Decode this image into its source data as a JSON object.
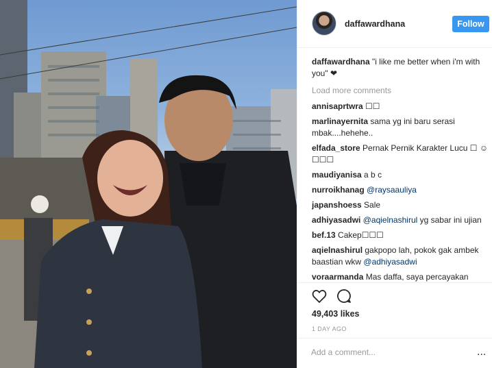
{
  "post": {
    "username": "daffawardhana",
    "follow_label": "Follow",
    "avatar_icon": "profile-avatar",
    "photo_icon": "couple-photo"
  },
  "caption": {
    "username": "daffawardhana",
    "text": "\"i like me better when i'm with you\" ❤"
  },
  "load_more": "Load more comments",
  "comments": [
    {
      "user": "annisaprtwra",
      "text": "☐☐"
    },
    {
      "user": "marlinayernita",
      "text": "sama yg ini baru serasi mbak....hehehe.."
    },
    {
      "user": "elfada_store",
      "text": "Pernak Pernik Karakter Lucu ☐ ☺☐☐☐"
    },
    {
      "user": "maudiyanisa",
      "text": "a b c"
    },
    {
      "user": "nurroikhanag",
      "mention": "@raysaauliya"
    },
    {
      "user": "japanshoess",
      "text": "Sale"
    },
    {
      "user": "adhiyasadwi",
      "mention": "@aqielnashirul",
      "text2": "yg sabar ini ujian"
    },
    {
      "user": "bef.13",
      "text": "Cakep☐☐☐"
    },
    {
      "user": "aqielnashirul",
      "text": "gakpopo lah, pokok gak ambek baastian wkw",
      "mention2": "@adhiyasadwi"
    },
    {
      "user": "voraarmanda",
      "text": "Mas daffa, saya percayakan"
    }
  ],
  "actions": {
    "heart_icon": "heart-icon",
    "comment_icon": "comment-icon",
    "likes": "49,403 likes",
    "time": "1 DAY AGO"
  },
  "add_comment": {
    "placeholder": "Add a comment...",
    "more_label": "..."
  }
}
